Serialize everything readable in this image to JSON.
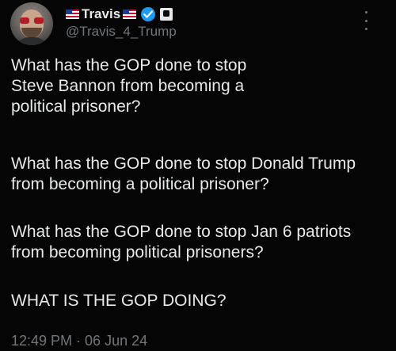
{
  "author": {
    "flag_left": "flag-us-icon",
    "display_name": "Travis",
    "flag_right": "flag-us-icon",
    "handle": "@Travis_4_Trump"
  },
  "tweet": {
    "paragraph_1": "What has the GOP done to stop Steve Bannon from becoming a political prisoner?",
    "paragraph_2": "What has the GOP done to stop Donald Trump from becoming a political prisoner?",
    "paragraph_3": "What has the GOP done to stop Jan 6 patriots from becoming political prisoners?",
    "paragraph_4": "WHAT IS THE GOP DOING?"
  },
  "meta": {
    "time": "12:49 PM · 06 Jun 24"
  },
  "colors": {
    "background": "#050505",
    "text": "#e7e9ea",
    "muted": "#71767b",
    "verified": "#1d9bf0"
  }
}
